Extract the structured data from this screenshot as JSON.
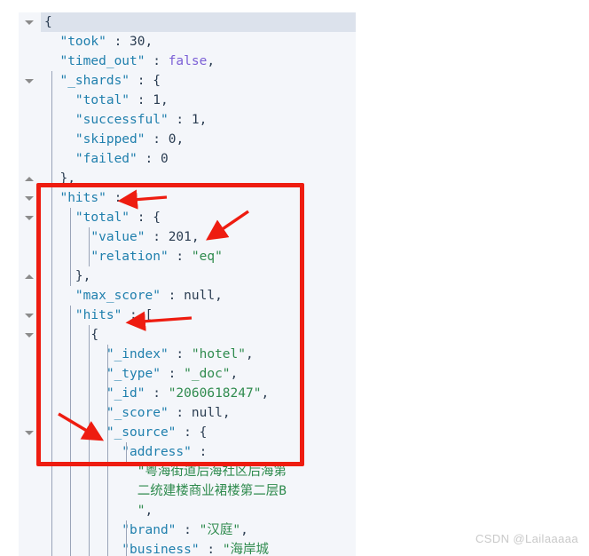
{
  "editor": {
    "language": "json",
    "current_line_index": 0,
    "colors": {
      "background": "#f4f6fa",
      "current_line": "#dce2ec",
      "key": "#1f7fad",
      "string": "#2f8b4e",
      "number": "#2b3d52",
      "boolean": "#7b5fd6",
      "null": "#2b3d52",
      "punctuation": "#2b3d52",
      "indent_guide": "#9aa4b8",
      "annotation": "#ee1c10",
      "watermark": "#c9c9c9"
    },
    "lines": [
      {
        "tokens": [
          {
            "t": "{",
            "c": "p"
          }
        ]
      },
      {
        "tokens": [
          {
            "t": "  \"took\"",
            "c": "k"
          },
          {
            "t": " : ",
            "c": "p"
          },
          {
            "t": "30",
            "c": "n"
          },
          {
            "t": ",",
            "c": "p"
          }
        ]
      },
      {
        "tokens": [
          {
            "t": "  \"timed_out\"",
            "c": "k"
          },
          {
            "t": " : ",
            "c": "p"
          },
          {
            "t": "false",
            "c": "b"
          },
          {
            "t": ",",
            "c": "p"
          }
        ]
      },
      {
        "tokens": [
          {
            "t": "  \"_shards\"",
            "c": "k"
          },
          {
            "t": " : {",
            "c": "p"
          }
        ]
      },
      {
        "tokens": [
          {
            "t": "    \"total\"",
            "c": "k"
          },
          {
            "t": " : ",
            "c": "p"
          },
          {
            "t": "1",
            "c": "n"
          },
          {
            "t": ",",
            "c": "p"
          }
        ]
      },
      {
        "tokens": [
          {
            "t": "    \"successful\"",
            "c": "k"
          },
          {
            "t": " : ",
            "c": "p"
          },
          {
            "t": "1",
            "c": "n"
          },
          {
            "t": ",",
            "c": "p"
          }
        ]
      },
      {
        "tokens": [
          {
            "t": "    \"skipped\"",
            "c": "k"
          },
          {
            "t": " : ",
            "c": "p"
          },
          {
            "t": "0",
            "c": "n"
          },
          {
            "t": ",",
            "c": "p"
          }
        ]
      },
      {
        "tokens": [
          {
            "t": "    \"failed\"",
            "c": "k"
          },
          {
            "t": " : ",
            "c": "p"
          },
          {
            "t": "0",
            "c": "n"
          }
        ]
      },
      {
        "tokens": [
          {
            "t": "  },",
            "c": "p"
          }
        ]
      },
      {
        "tokens": [
          {
            "t": "  \"hits\"",
            "c": "k"
          },
          {
            "t": " : {",
            "c": "p"
          }
        ]
      },
      {
        "tokens": [
          {
            "t": "    \"total\"",
            "c": "k"
          },
          {
            "t": " : {",
            "c": "p"
          }
        ]
      },
      {
        "tokens": [
          {
            "t": "      \"value\"",
            "c": "k"
          },
          {
            "t": " : ",
            "c": "p"
          },
          {
            "t": "201",
            "c": "n"
          },
          {
            "t": ",",
            "c": "p"
          }
        ]
      },
      {
        "tokens": [
          {
            "t": "      \"relation\"",
            "c": "k"
          },
          {
            "t": " : ",
            "c": "p"
          },
          {
            "t": "\"eq\"",
            "c": "s"
          }
        ]
      },
      {
        "tokens": [
          {
            "t": "    },",
            "c": "p"
          }
        ]
      },
      {
        "tokens": [
          {
            "t": "    \"max_score\"",
            "c": "k"
          },
          {
            "t": " : ",
            "c": "p"
          },
          {
            "t": "null",
            "c": "nul"
          },
          {
            "t": ",",
            "c": "p"
          }
        ]
      },
      {
        "tokens": [
          {
            "t": "    \"hits\"",
            "c": "k"
          },
          {
            "t": " : [",
            "c": "p"
          }
        ]
      },
      {
        "tokens": [
          {
            "t": "      {",
            "c": "p"
          }
        ]
      },
      {
        "tokens": [
          {
            "t": "        \"_index\"",
            "c": "k"
          },
          {
            "t": " : ",
            "c": "p"
          },
          {
            "t": "\"hotel\"",
            "c": "s"
          },
          {
            "t": ",",
            "c": "p"
          }
        ]
      },
      {
        "tokens": [
          {
            "t": "        \"_type\"",
            "c": "k"
          },
          {
            "t": " : ",
            "c": "p"
          },
          {
            "t": "\"_doc\"",
            "c": "s"
          },
          {
            "t": ",",
            "c": "p"
          }
        ]
      },
      {
        "tokens": [
          {
            "t": "        \"_id\"",
            "c": "k"
          },
          {
            "t": " : ",
            "c": "p"
          },
          {
            "t": "\"2060618247\"",
            "c": "s"
          },
          {
            "t": ",",
            "c": "p"
          }
        ]
      },
      {
        "tokens": [
          {
            "t": "        \"_score\"",
            "c": "k"
          },
          {
            "t": " : ",
            "c": "p"
          },
          {
            "t": "null",
            "c": "nul"
          },
          {
            "t": ",",
            "c": "p"
          }
        ]
      },
      {
        "tokens": [
          {
            "t": "        \"_source\"",
            "c": "k"
          },
          {
            "t": " : {",
            "c": "p"
          }
        ]
      },
      {
        "tokens": [
          {
            "t": "          \"address\"",
            "c": "k"
          },
          {
            "t": " : ",
            "c": "p"
          }
        ]
      },
      {
        "tokens": [
          {
            "t": "            \"粤海街道后海社区后海第",
            "c": "s"
          }
        ]
      },
      {
        "tokens": [
          {
            "t": "            二统建楼商业裙楼第二层B",
            "c": "s"
          }
        ]
      },
      {
        "tokens": [
          {
            "t": "            \"",
            "c": "s"
          },
          {
            "t": ",",
            "c": "p"
          }
        ]
      },
      {
        "tokens": [
          {
            "t": "          \"brand\"",
            "c": "k"
          },
          {
            "t": " : ",
            "c": "p"
          },
          {
            "t": "\"汉庭\"",
            "c": "s"
          },
          {
            "t": ",",
            "c": "p"
          }
        ]
      },
      {
        "tokens": [
          {
            "t": "          \"business\"",
            "c": "k"
          },
          {
            "t": " : ",
            "c": "p"
          },
          {
            "t": "\"海岸城",
            "c": "s"
          }
        ]
      }
    ],
    "fold_markers": [
      {
        "line": 0,
        "state": "expanded",
        "glyph": "chevron-down"
      },
      {
        "line": 3,
        "state": "expanded",
        "glyph": "chevron-down"
      },
      {
        "line": 8,
        "state": "collapsed",
        "glyph": "chevron-up"
      },
      {
        "line": 9,
        "state": "expanded",
        "glyph": "chevron-down"
      },
      {
        "line": 10,
        "state": "expanded",
        "glyph": "chevron-down"
      },
      {
        "line": 13,
        "state": "collapsed",
        "glyph": "chevron-up"
      },
      {
        "line": 15,
        "state": "expanded",
        "glyph": "chevron-down"
      },
      {
        "line": 16,
        "state": "expanded",
        "glyph": "chevron-down"
      },
      {
        "line": 21,
        "state": "expanded",
        "glyph": "chevron-down"
      }
    ]
  },
  "annotations": {
    "highlight_box": {
      "label": "red-rectangle-highlight",
      "color": "#ee1c10",
      "covers": "hits block from \"hits\" through \"address\""
    },
    "arrows": [
      {
        "name": "arrow-hits-total",
        "points_to": "\"hits\"",
        "direction": "left"
      },
      {
        "name": "arrow-total-value",
        "points_to": "\"value\" : 201",
        "direction": "down-left"
      },
      {
        "name": "arrow-hits-array",
        "points_to": "\"hits\" : [",
        "direction": "left"
      },
      {
        "name": "arrow-source",
        "points_to": "\"_source\"",
        "direction": "down-right"
      }
    ]
  },
  "watermark": {
    "text": "CSDN @Lailaaaaa"
  }
}
